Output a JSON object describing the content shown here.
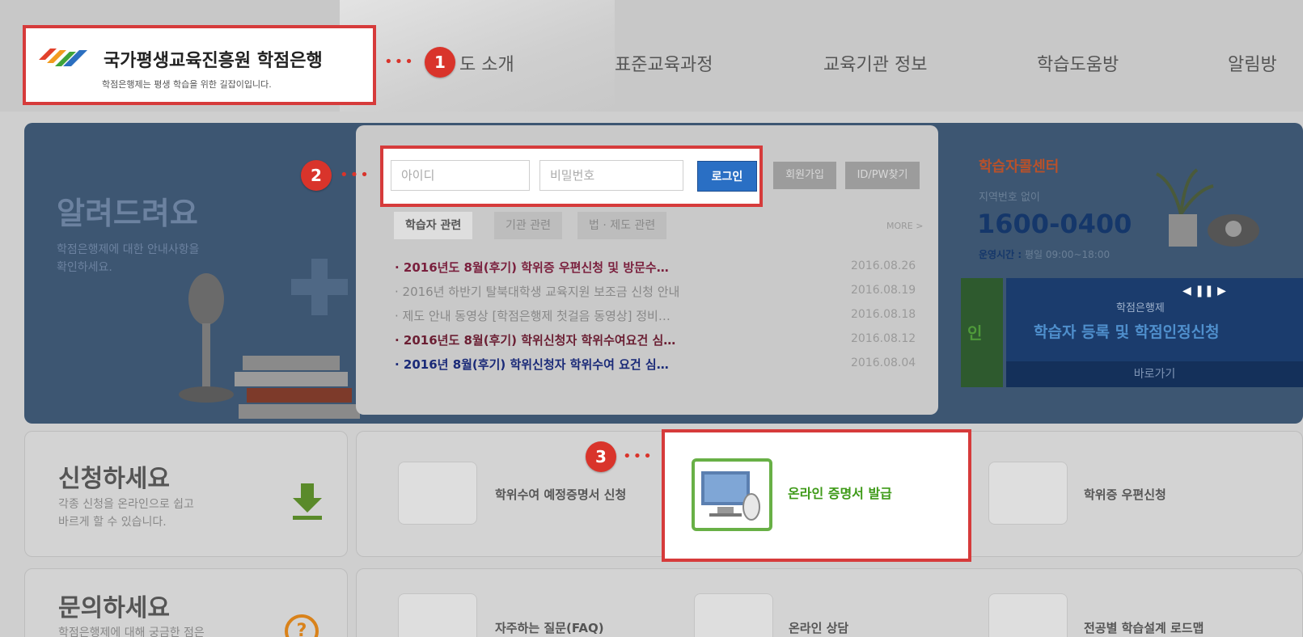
{
  "header": {
    "logo_title": "국가평생교육진흥원 학점은행",
    "logo_subtitle": "학점은행제는 평생 학습을 위한 길잡이입니다.",
    "nav": [
      "도 소개",
      "표준교육과정",
      "교육기관 정보",
      "학습도움방",
      "알림방"
    ]
  },
  "callouts": [
    "1",
    "2",
    "3"
  ],
  "notice_side": {
    "title": "알려드려요",
    "subtitle_line1": "학점은행제에 대한 안내사항을",
    "subtitle_line2": "확인하세요."
  },
  "login": {
    "id_placeholder": "아이디",
    "pw_placeholder": "비밀번호",
    "login_label": "로그인",
    "signup_label": "회원가입",
    "find_label": "ID/PW찾기"
  },
  "tabs": [
    "학습자 관련",
    "기관 관련",
    "법 · 제도 관련"
  ],
  "more_label": "MORE >",
  "news": [
    {
      "title": "2016년도 8월(후기) 학위증 우편신청 및 방문수…",
      "date": "2016.08.26",
      "color": "#7a1f3d"
    },
    {
      "title": "2016년 하반기 탈북대학생 교육지원 보조금 신청 안내",
      "date": "2016.08.19",
      "color": "#888888"
    },
    {
      "title": "제도 안내 동영상 [학점은행제 첫걸음 동영상] 정비…",
      "date": "2016.08.18",
      "color": "#888888"
    },
    {
      "title": "2016년도 8월(후기) 학위신청자 학위수여요건 심…",
      "date": "2016.08.12",
      "color": "#6b1f33"
    },
    {
      "title": "2016년 8월(후기) 학위신청자 학위수여 요건 심…",
      "date": "2016.08.04",
      "color": "#1a2a78"
    }
  ],
  "call_center": {
    "title": "학습자콜센터",
    "sub": "지역번호 없이",
    "phone": "1600-0400",
    "hours_label": "운영시간 :",
    "hours_value": "평일 09:00~18:00"
  },
  "banner": {
    "small": "학점은행제",
    "big": "학습자 등록 및 학점인정신청",
    "go": "바로가기",
    "green_char": "인"
  },
  "apply": {
    "title": "신청하세요",
    "sub_line1": "각종 신청을 온라인으로 쉽고",
    "sub_line2": "바르게 할 수 있습니다."
  },
  "inquiry": {
    "title": "문의하세요",
    "sub_line1": "학점은행제에 대해 궁금한 점은"
  },
  "services_row1": [
    "학위수여 예정증명서 신청",
    "온라인 증명서 발급",
    "학위증 우편신청"
  ],
  "services_row2": [
    "자주하는 질문(FAQ)",
    "온라인 상담",
    "전공별 학습설계 로드맵"
  ]
}
